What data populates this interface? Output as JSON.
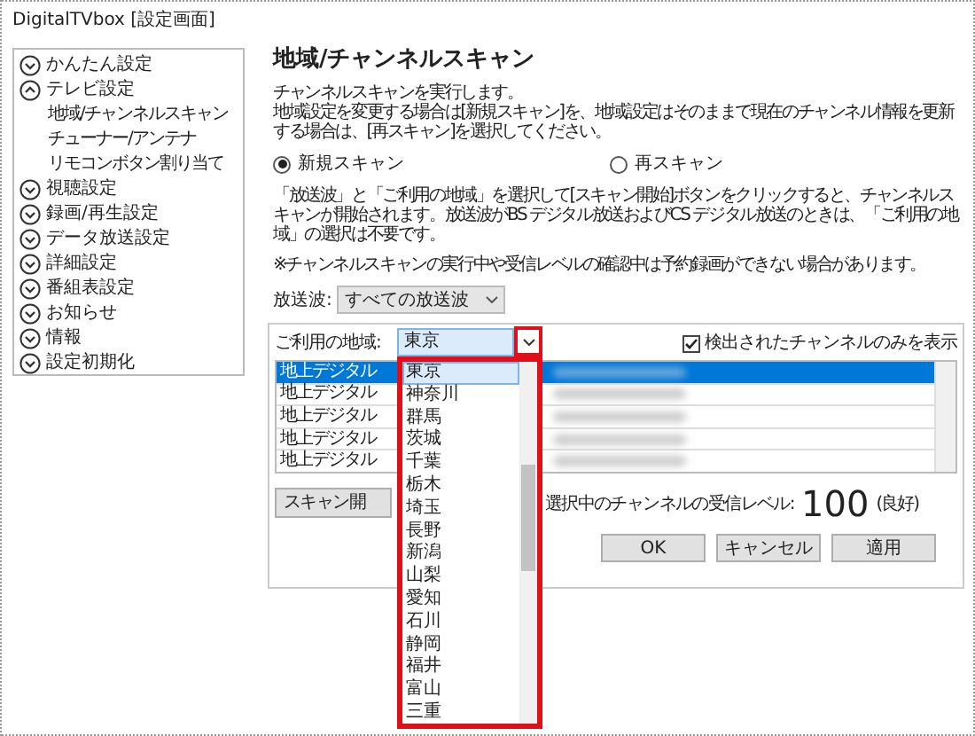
{
  "window": {
    "title": "DigitalTVbox [設定画面]"
  },
  "sidebar": {
    "items": [
      {
        "label": "かんたん設定",
        "expanded": false
      },
      {
        "label": "テレビ設定",
        "expanded": true,
        "children": [
          {
            "label": "地域/チャンネルスキャン"
          },
          {
            "label": "チューナー/アンテナ"
          },
          {
            "label": "リモコンボタン割り当て"
          }
        ]
      },
      {
        "label": "視聴設定",
        "expanded": false
      },
      {
        "label": "録画/再生設定",
        "expanded": false
      },
      {
        "label": "データ放送設定",
        "expanded": false
      },
      {
        "label": "詳細設定",
        "expanded": false
      },
      {
        "label": "番組表設定",
        "expanded": false
      },
      {
        "label": "お知らせ",
        "expanded": false
      },
      {
        "label": "情報",
        "expanded": false
      },
      {
        "label": "設定初期化",
        "expanded": false
      }
    ]
  },
  "heading": "地域/チャンネルスキャン",
  "description": [
    "チャンネルスキャンを実行します。",
    "地域設定を変更する場合は[新規スキャン]を、地域設定はそのままで現在のチャンネル情報を更新する場合は、[再スキャン]を選択してください。"
  ],
  "scan_modes": [
    {
      "label": "新規スキャン",
      "selected": true
    },
    {
      "label": "再スキャン",
      "selected": false
    }
  ],
  "instructions": "「放送波」と「ご利用の地域」を選択して[スキャン開始]ボタンをクリックすると、チャンネルスキャンが開始されます。放送波がBS デジタル放送およびCS デジタル放送のときは、「ご利用の地域」の選択は不要です。",
  "note": "※チャンネルスキャンの実行中や受信レベルの確認中は予約録画ができない場合があります。",
  "broadcast": {
    "label": "放送波:",
    "value": "すべての放送波"
  },
  "region": {
    "label": "ご利用の地域:",
    "value": "東京",
    "options": [
      {
        "label": "東京",
        "selected": true
      },
      {
        "label": "神奈川",
        "selected": false
      },
      {
        "label": "群馬",
        "selected": false
      },
      {
        "label": "茨城",
        "selected": false
      },
      {
        "label": "千葉",
        "selected": false
      },
      {
        "label": "栃木",
        "selected": false
      },
      {
        "label": "埼玉",
        "selected": false
      },
      {
        "label": "長野",
        "selected": false
      },
      {
        "label": "新潟",
        "selected": false
      },
      {
        "label": "山梨",
        "selected": false
      },
      {
        "label": "愛知",
        "selected": false
      },
      {
        "label": "石川",
        "selected": false
      },
      {
        "label": "静岡",
        "selected": false
      },
      {
        "label": "福井",
        "selected": false
      },
      {
        "label": "富山",
        "selected": false
      },
      {
        "label": "三重",
        "selected": false
      }
    ]
  },
  "detected_only": {
    "label": "検出されたチャンネルのみを表示",
    "checked": true
  },
  "channels": [
    {
      "type": "地上デジタル",
      "selected": true
    },
    {
      "type": "地上デジタル",
      "selected": false
    },
    {
      "type": "地上デジタル",
      "selected": false
    },
    {
      "type": "地上デジタル",
      "selected": false
    },
    {
      "type": "地上デジタル",
      "selected": false
    }
  ],
  "scan_button": "スキャン開",
  "signal": {
    "label": "選択中のチャンネルの受信レベル:",
    "value": "100",
    "quality": "(良好)"
  },
  "buttons": [
    "OK",
    "キャンセル",
    "適用"
  ]
}
